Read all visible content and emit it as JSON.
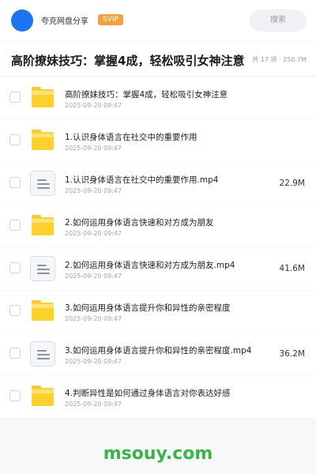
{
  "header": {
    "app_title": "夸克网盘分享",
    "vip_badge": "SVIP",
    "search_label": "搜索"
  },
  "folder": {
    "title": "高阶撩妹技巧：掌握4成，轻松吸引女神注意",
    "meta": "共 17 项 · 250.7M"
  },
  "files": [
    {
      "type": "folder",
      "name": "高阶撩妹技巧：掌握4成，轻松吸引女神注意",
      "date": "2025-09-20 09:47",
      "size": ""
    },
    {
      "type": "folder",
      "name": "1.认识身体语言在社交中的重要作用",
      "date": "2025-09-20 09:47",
      "size": ""
    },
    {
      "type": "video",
      "name": "1.认识身体语言在社交中的重要作用.mp4",
      "date": "2025-09-20 09:47",
      "size": "22.9M"
    },
    {
      "type": "folder",
      "name": "2.如何运用身体语言快速和对方成为朋友",
      "date": "2025-09-20 09:47",
      "size": ""
    },
    {
      "type": "video",
      "name": "2.如何运用身体语言快速和对方成为朋友.mp4",
      "date": "2025-09-20 09:47",
      "size": "41.6M"
    },
    {
      "type": "folder",
      "name": "3.如何运用身体语言提升你和异性的亲密程度",
      "date": "2025-09-20 09:47",
      "size": ""
    },
    {
      "type": "video",
      "name": "3.如何运用身体语言提升你和异性的亲密程度.mp4",
      "date": "2025-09-20 09:47",
      "size": "36.2M"
    },
    {
      "type": "folder",
      "name": "4.判断异性是如何通过身体语言对你表达好感",
      "date": "2025-09-20 09:47",
      "size": ""
    }
  ],
  "watermark": "msouy.com",
  "colors": {
    "accent": "#1e73f0",
    "vip": "#f2a13a",
    "folder": "#fdd12c",
    "watermark": "#3bb34a"
  }
}
